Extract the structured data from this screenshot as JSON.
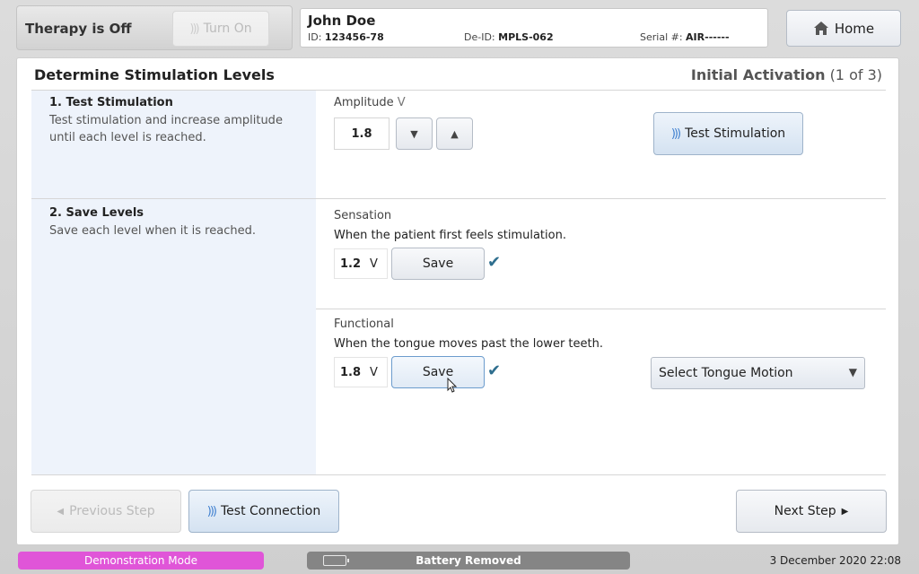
{
  "header": {
    "therapy_status": "Therapy is Off",
    "turn_on_label": "Turn On",
    "patient": {
      "name": "John Doe",
      "id_label": "ID:",
      "id_value": "123456-78",
      "deid_label": "De-ID:",
      "deid_value": "MPLS-062",
      "serial_label": "Serial #:",
      "serial_value": "AIR------"
    },
    "home_label": "Home"
  },
  "panel": {
    "title": "Determine Stimulation Levels",
    "progress_title": "Initial Activation",
    "progress_step": "(1 of 3)",
    "step1": {
      "title": "1. Test Stimulation",
      "description": "Test stimulation and increase amplitude until each level is reached.",
      "amplitude_label": "Amplitude",
      "unit": "V",
      "amplitude_value": "1.8",
      "down_icon": "triangle-down-icon",
      "up_icon": "triangle-up-icon",
      "test_stimulation_label": "Test Stimulation"
    },
    "step2": {
      "title": "2. Save Levels",
      "description": "Save each level when it is reached.",
      "sensation": {
        "label": "Sensation",
        "description": "When the patient first feels stimulation.",
        "value": "1.2",
        "unit": "V",
        "save_label": "Save"
      },
      "functional": {
        "label": "Functional",
        "description": "When the tongue moves past the lower teeth.",
        "value": "1.8",
        "unit": "V",
        "save_label": "Save"
      },
      "tongue_motion_select": "Select Tongue Motion"
    },
    "footer": {
      "previous_label": "Previous Step",
      "test_connection_label": "Test Connection",
      "next_label": "Next Step"
    }
  },
  "statusbar": {
    "demo_mode": "Demonstration Mode",
    "battery": "Battery Removed",
    "datetime": "3 December 2020 22:08"
  },
  "colors": {
    "demo_mode_bg": "#e055d8",
    "check_color": "#2e6e8e",
    "wave_icon_color": "#3e7fcf",
    "side_column_bg": "#eef3fb"
  }
}
